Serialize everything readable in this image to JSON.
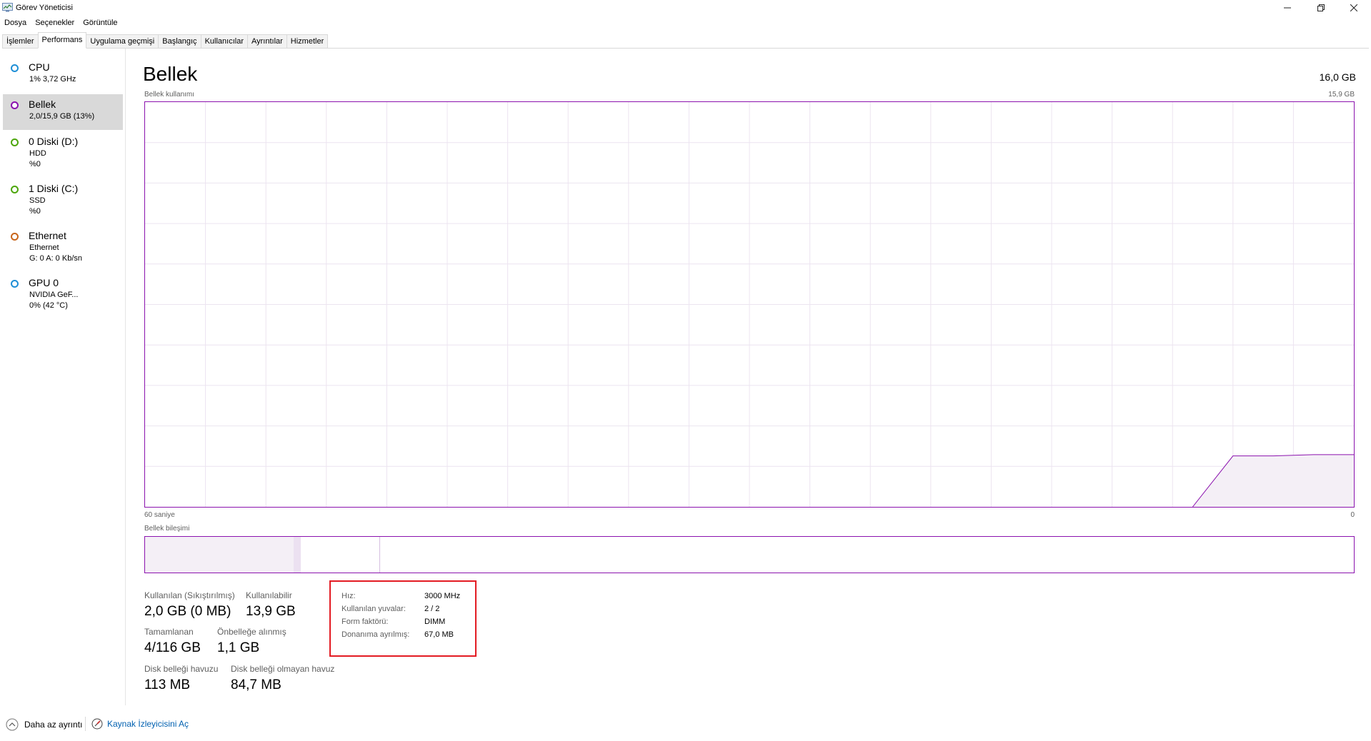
{
  "window": {
    "title": "Görev Yöneticisi",
    "icon": "task-manager-icon",
    "controls": [
      "minimize-icon",
      "restore-icon",
      "close-icon"
    ]
  },
  "menu": [
    "Dosya",
    "Seçenekler",
    "Görüntüle"
  ],
  "tabs": [
    {
      "label": "İşlemler",
      "active": false
    },
    {
      "label": "Performans",
      "active": true
    },
    {
      "label": "Uygulama geçmişi",
      "active": false
    },
    {
      "label": "Başlangıç",
      "active": false
    },
    {
      "label": "Kullanıcılar",
      "active": false
    },
    {
      "label": "Ayrıntılar",
      "active": false
    },
    {
      "label": "Hizmetler",
      "active": false
    }
  ],
  "sidebar": {
    "items": [
      {
        "title": "CPU",
        "lines": [
          "1% 3,72 GHz"
        ],
        "color": "#1f8fd6",
        "active": false
      },
      {
        "title": "Bellek",
        "lines": [
          "2,0/15,9 GB (13%)"
        ],
        "color": "#8b12ae",
        "active": true
      },
      {
        "title": "0 Diski (D:)",
        "lines": [
          "HDD",
          "%0"
        ],
        "color": "#4da60c",
        "active": false
      },
      {
        "title": "1 Diski (C:)",
        "lines": [
          "SSD",
          "%0"
        ],
        "color": "#4da60c",
        "active": false
      },
      {
        "title": "Ethernet",
        "lines": [
          "Ethernet",
          "G: 0 A: 0 Kb/sn"
        ],
        "color": "#c8651b",
        "active": false
      },
      {
        "title": "GPU 0",
        "lines": [
          "NVIDIA GeF...",
          "0% (42 °C)"
        ],
        "color": "#1f8fd6",
        "active": false
      }
    ]
  },
  "main": {
    "title": "Bellek",
    "total": "16,0 GB",
    "usage_label": "Bellek kullanımı",
    "usage_max": "15,9 GB",
    "time_label": "60 saniye",
    "zero_label": "0",
    "composition_label": "Bellek bileşimi",
    "accent_color": "#8b12ae"
  },
  "chart_data": {
    "type": "area",
    "title": "Bellek kullanımı",
    "ylim": [
      0,
      15.9
    ],
    "xlim": [
      60,
      0
    ],
    "grid": true,
    "x": [
      60,
      8,
      6,
      4,
      2,
      0
    ],
    "values": [
      null,
      0,
      2.0,
      2.0,
      2.05,
      2.05
    ]
  },
  "composition": {
    "in_use_fraction": 0.123,
    "modified_fraction": 0.006,
    "standby_fraction": 0.065
  },
  "stats": {
    "in_use_label": "Kullanılan (Sıkıştırılmış)",
    "in_use_value": "2,0 GB (0 MB)",
    "available_label": "Kullanılabilir",
    "available_value": "13,9 GB",
    "committed_label": "Tamamlanan",
    "committed_value": "4/116 GB",
    "cached_label": "Önbelleğe alınmış",
    "cached_value": "1,1 GB",
    "paged_label": "Disk belleği havuzu",
    "paged_value": "113 MB",
    "nonpaged_label": "Disk belleği olmayan havuz",
    "nonpaged_value": "84,7 MB"
  },
  "hardware": [
    {
      "label": "Hız:",
      "value": "3000 MHz"
    },
    {
      "label": "Kullanılan yuvalar:",
      "value": "2 / 2"
    },
    {
      "label": "Form faktörü:",
      "value": "DIMM"
    },
    {
      "label": "Donanıma ayrılmış:",
      "value": "67,0 MB"
    }
  ],
  "footer": {
    "fewer_details": "Daha az ayrıntı",
    "resource_monitor": "Kaynak İzleyicisini Aç"
  }
}
